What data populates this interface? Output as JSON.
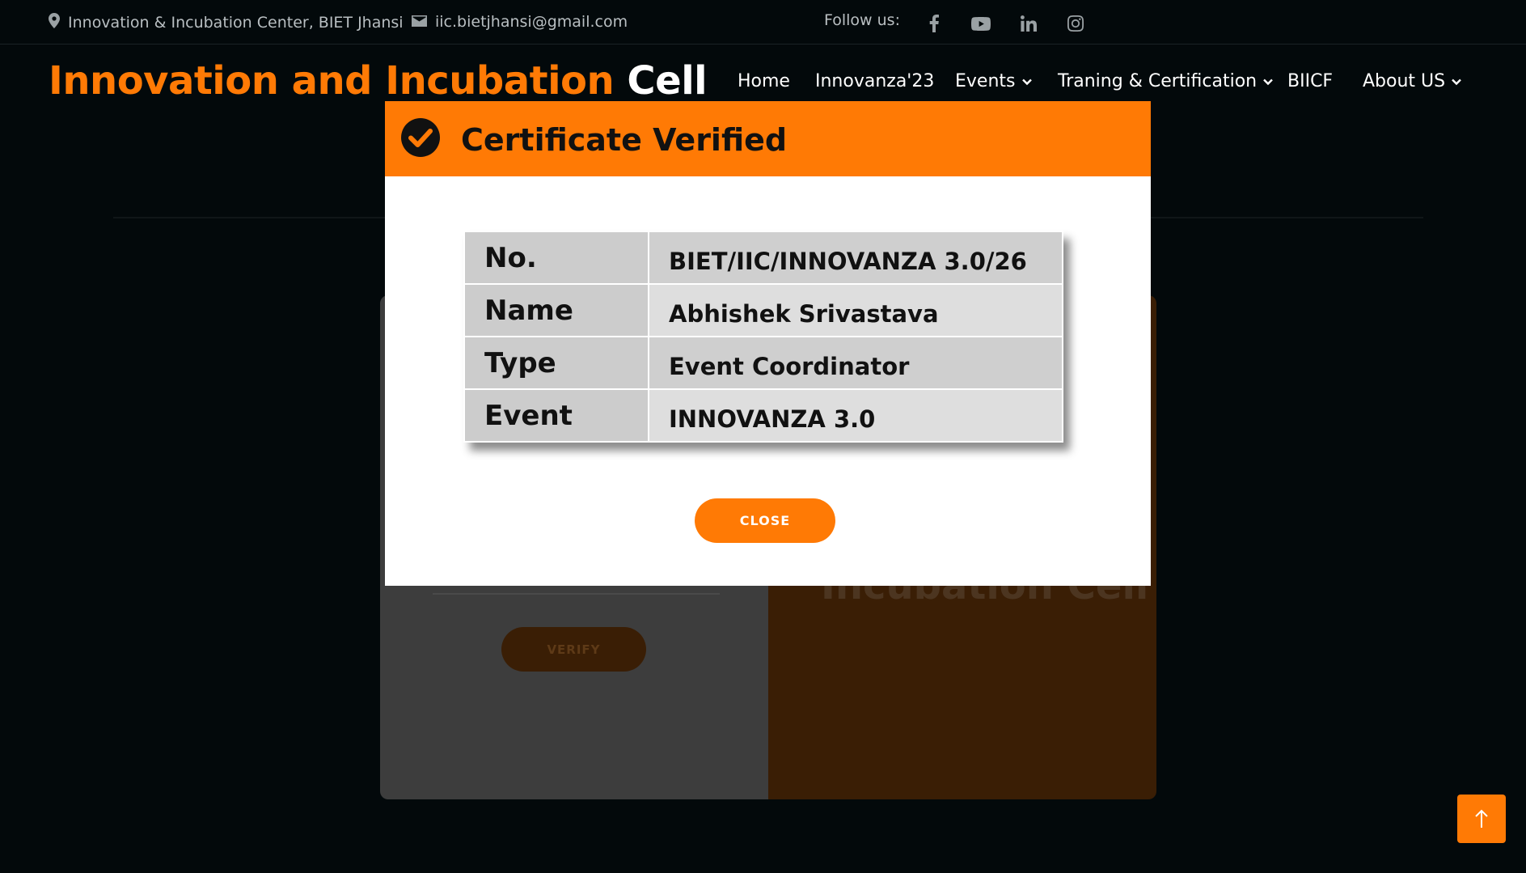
{
  "topbar": {
    "address": "Innovation & Incubation Center, BIET Jhansi",
    "email": "iic.bietjhansi@gmail.com",
    "follow_label": "Follow us:",
    "social_icons": [
      "facebook-icon",
      "youtube-icon",
      "linkedin-icon",
      "instagram-icon"
    ]
  },
  "header": {
    "brand_orange": "Innovation and Incubation",
    "brand_white": "Cell",
    "nav": {
      "home": "Home",
      "innovanza": "Innovanza'23",
      "events": "Events",
      "training": "Traning & Certification",
      "biicf": "BIICF",
      "about": "About US"
    }
  },
  "background": {
    "verify_label": "VERIFY",
    "right_title": "Incubation Cell"
  },
  "modal": {
    "title": "Certificate Verified",
    "rows": [
      {
        "key": "No.",
        "value": "BIET/IIC/INNOVANZA 3.0/26"
      },
      {
        "key": "Name",
        "value": "Abhishek Srivastava"
      },
      {
        "key": "Type",
        "value": "Event Coordinator"
      },
      {
        "key": "Event",
        "value": "INNOVANZA 3.0"
      }
    ],
    "close_label": "CLOSE"
  },
  "colors": {
    "accent": "#ff7a05",
    "page_bg": "#03090b",
    "modal_bg": "#ffffff"
  }
}
